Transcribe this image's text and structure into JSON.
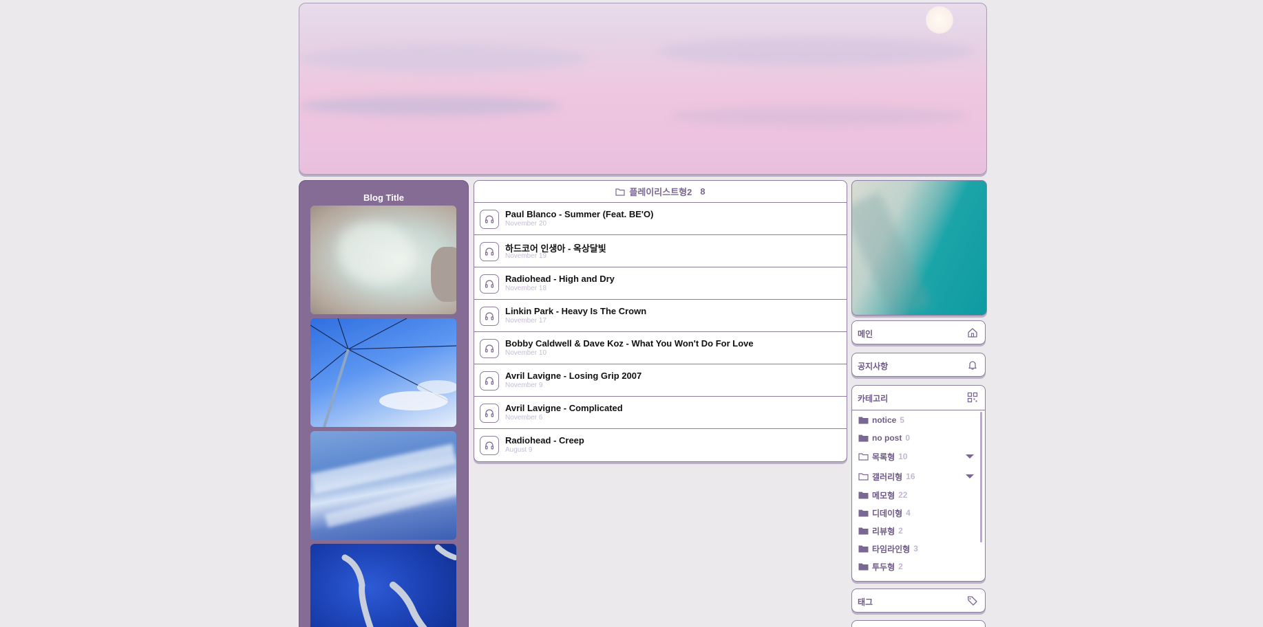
{
  "blog": {
    "title": "Blog Title"
  },
  "list": {
    "category_name": "플레이리스트형2",
    "count": "8",
    "posts": [
      {
        "title": "Paul Blanco - Summer (Feat. BE'O)",
        "date": "November 20"
      },
      {
        "title": "하드코어 인생아 - 옥상달빛",
        "date": "November 19"
      },
      {
        "title": "Radiohead - High and Dry",
        "date": "November 18"
      },
      {
        "title": "Linkin Park - Heavy Is The Crown",
        "date": "November 17"
      },
      {
        "title": "Bobby Caldwell & Dave Koz - What You Won't Do For Love",
        "date": "November 10"
      },
      {
        "title": "Avril Lavigne - Losing Grip 2007",
        "date": "November 9"
      },
      {
        "title": "Avril Lavigne - Complicated",
        "date": "November 6"
      },
      {
        "title": "Radiohead - Creep",
        "date": "August 9"
      }
    ]
  },
  "sidebar": {
    "home_label": "메인",
    "notice_label": "공지사항",
    "category_label": "카테고리",
    "tag_label": "태그",
    "categories": [
      {
        "name": "notice",
        "count": "5",
        "icon": "folder-filled-icon"
      },
      {
        "name": "no post",
        "count": "0",
        "icon": "folder-filled-icon"
      },
      {
        "name": "목록형",
        "count": "10",
        "icon": "folder-outline-icon"
      },
      {
        "name": "갤러리형",
        "count": "16",
        "icon": "folder-outline-icon"
      },
      {
        "name": "메모형",
        "count": "22",
        "icon": "folder-filled-icon"
      },
      {
        "name": "디데이형",
        "count": "4",
        "icon": "folder-filled-icon"
      },
      {
        "name": "리뷰형",
        "count": "2",
        "icon": "folder-filled-icon"
      },
      {
        "name": "타임라인형",
        "count": "3",
        "icon": "folder-filled-icon"
      },
      {
        "name": "투두형",
        "count": "2",
        "icon": "folder-filled-icon"
      }
    ]
  },
  "colors": {
    "accent": "#846c94",
    "border": "#8c7c9e",
    "date_text": "#c7bdd6"
  }
}
